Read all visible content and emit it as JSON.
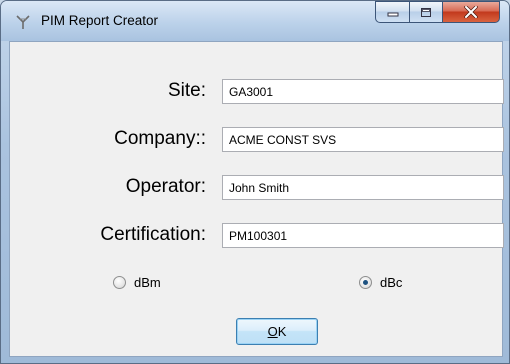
{
  "window": {
    "title": "PIM Report Creator",
    "controls": {
      "minimize": "minimize",
      "maximize": "maximize",
      "close": "close"
    }
  },
  "form": {
    "site": {
      "label": "Site:",
      "value": "GA3001"
    },
    "company": {
      "label": "Company::",
      "value": "ACME CONST SVS"
    },
    "operator": {
      "label": "Operator:",
      "value": "John Smith"
    },
    "certification": {
      "label": "Certification:",
      "value": "PM100301"
    }
  },
  "units": {
    "options": [
      {
        "label": "dBm",
        "selected": false
      },
      {
        "label": "dBc",
        "selected": true
      }
    ]
  },
  "ok_button": {
    "mnemonic": "O",
    "rest": "K"
  },
  "colors": {
    "close_button": "#c2391d",
    "title_bar": "#bcd2ea",
    "client_bg": "#f0f0f0"
  },
  "icons": {
    "app": "antenna-icon"
  }
}
